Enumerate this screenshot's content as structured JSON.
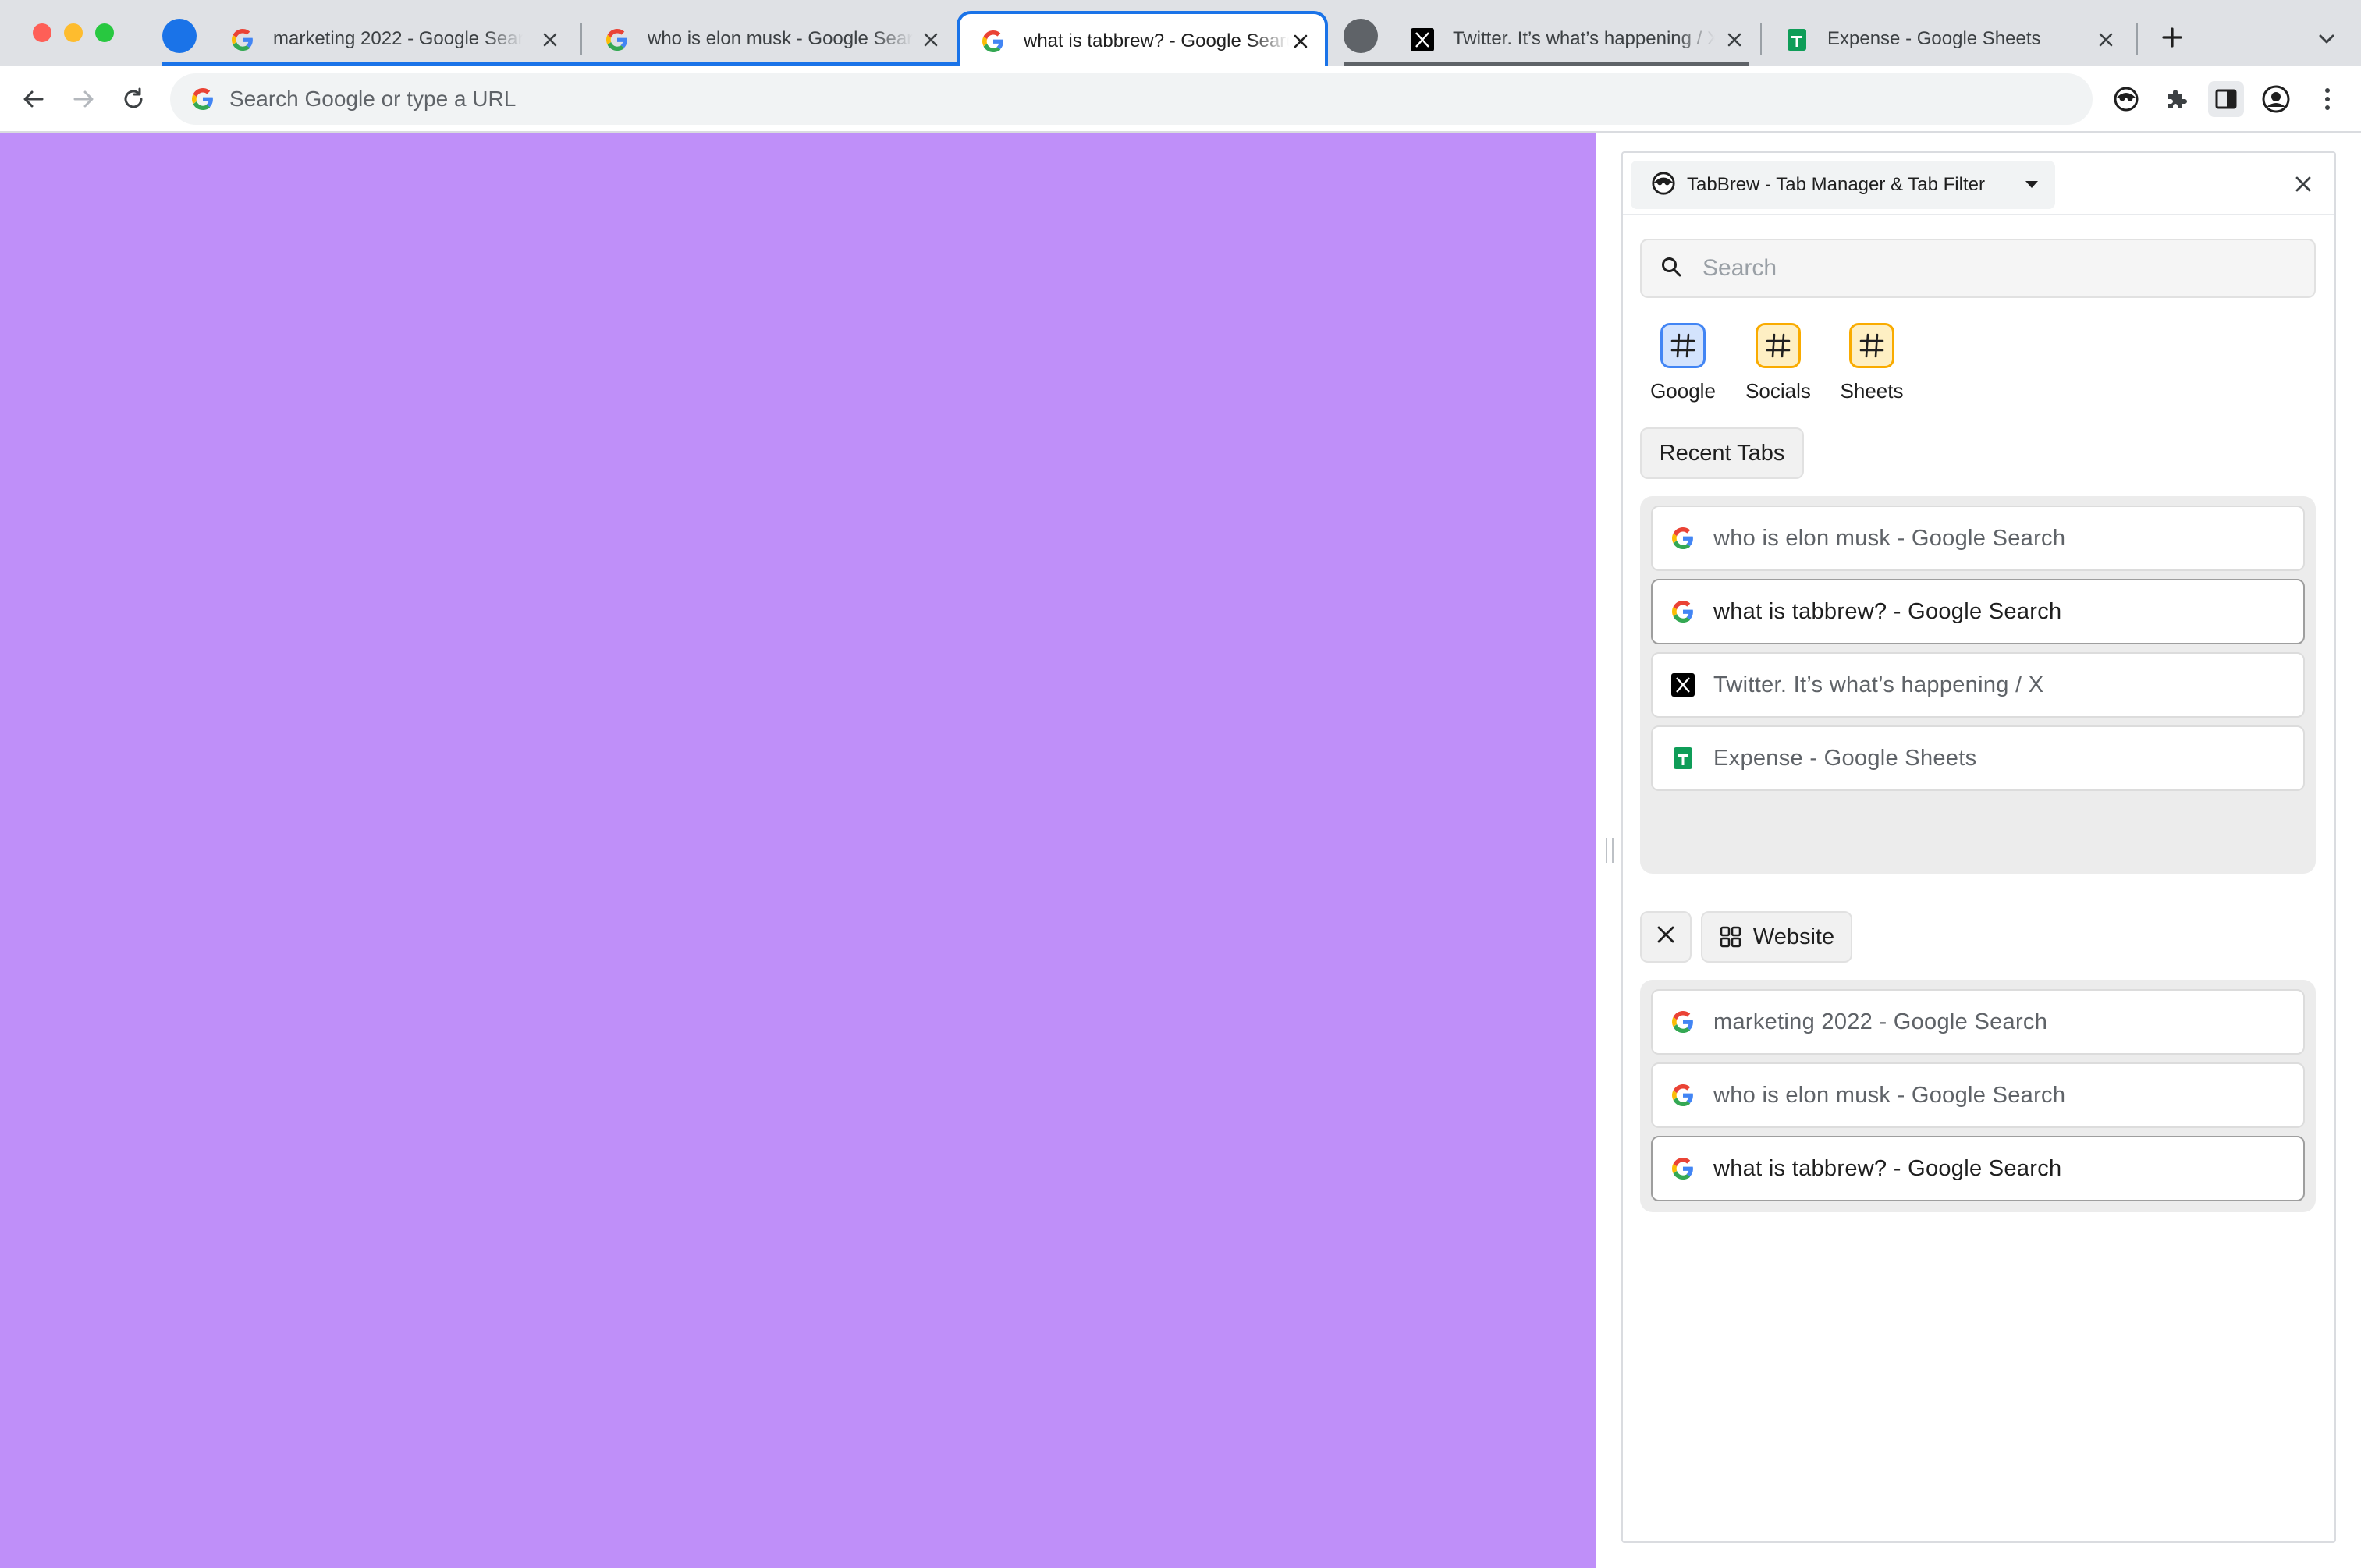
{
  "browser": {
    "tabs": [
      {
        "title": "marketing 2022 - Google Search",
        "favicon": "google-icon",
        "group": "blue"
      },
      {
        "title": "who is elon musk - Google Search",
        "favicon": "google-icon",
        "group": "blue"
      },
      {
        "title": "what is tabbrew? - Google Search",
        "favicon": "google-icon",
        "group": "blue",
        "active": true
      },
      {
        "title": "Twitter. It’s what’s happening / X",
        "favicon": "x-icon",
        "group": "grey"
      },
      {
        "title": "Expense - Google Sheets",
        "favicon": "sheets-icon"
      }
    ],
    "omnibox": {
      "placeholder": "Search Google or type a URL"
    }
  },
  "side_panel": {
    "title": "TabBrew - Tab Manager & Tab Filter",
    "search": {
      "placeholder": "Search"
    },
    "groups": [
      {
        "label": "Google",
        "color": "#4285f4"
      },
      {
        "label": "Socials",
        "color": "#f9ab00"
      },
      {
        "label": "Sheets",
        "color": "#f9ab00"
      }
    ],
    "recent_tabs": {
      "label": "Recent Tabs",
      "items": [
        {
          "title": "who is elon musk - Google Search",
          "favicon": "google-icon"
        },
        {
          "title": "what is tabbrew? - Google Search",
          "favicon": "google-icon",
          "current": true
        },
        {
          "title": "Twitter. It’s what’s happening / X",
          "favicon": "x-icon"
        },
        {
          "title": "Expense - Google Sheets",
          "favicon": "sheets-icon"
        }
      ]
    },
    "filter": {
      "label": "Website",
      "items": [
        {
          "title": "marketing 2022 - Google Search",
          "favicon": "google-icon"
        },
        {
          "title": "who is elon musk - Google Search",
          "favicon": "google-icon"
        },
        {
          "title": "what is tabbrew? - Google Search",
          "favicon": "google-icon",
          "current": true
        }
      ]
    }
  },
  "colors": {
    "page_background": "#bf8ff9",
    "accent": "#1a73e8"
  }
}
